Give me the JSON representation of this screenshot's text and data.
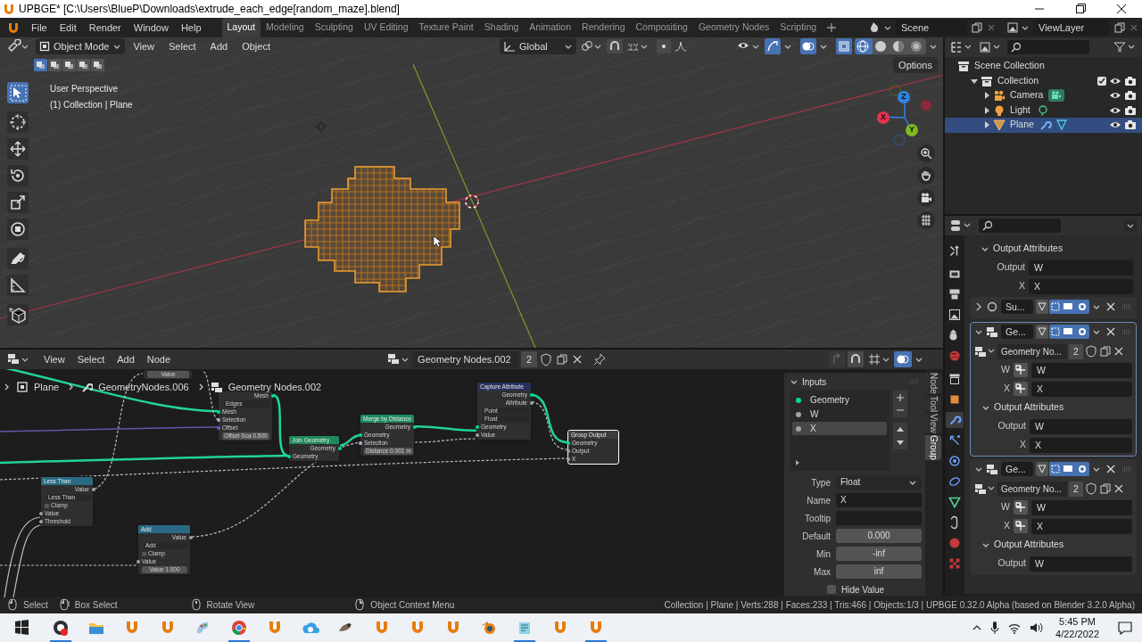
{
  "window": {
    "title": "UPBGE* [C:\\Users\\BlueP\\Downloads\\extrude_each_edge[random_maze].blend]"
  },
  "menu": [
    "File",
    "Edit",
    "Render",
    "Window",
    "Help"
  ],
  "workspaces": [
    {
      "label": "Layout",
      "selected": true
    },
    {
      "label": "Modeling",
      "selected": false
    },
    {
      "label": "Sculpting",
      "selected": false
    },
    {
      "label": "UV Editing",
      "selected": false
    },
    {
      "label": "Texture Paint",
      "selected": false
    },
    {
      "label": "Shading",
      "selected": false
    },
    {
      "label": "Animation",
      "selected": false
    },
    {
      "label": "Rendering",
      "selected": false
    },
    {
      "label": "Compositing",
      "selected": false
    },
    {
      "label": "Geometry Nodes",
      "selected": false
    },
    {
      "label": "Scripting",
      "selected": false
    }
  ],
  "scene": "Scene",
  "view_layer": "ViewLayer",
  "viewport": {
    "mode": "Object Mode",
    "menus": [
      "View",
      "Select",
      "Add",
      "Object"
    ],
    "orientation": "Global",
    "options": "Options",
    "select_modes": [
      {
        "selected": true
      },
      {
        "selected": false
      },
      {
        "selected": false
      },
      {
        "selected": false
      },
      {
        "selected": false
      }
    ],
    "shading": [
      {
        "kind": "wireframe",
        "selected": true
      },
      {
        "kind": "solid",
        "selected": false
      },
      {
        "kind": "material",
        "selected": false
      },
      {
        "kind": "rendered",
        "selected": false
      }
    ],
    "overlay_lines": [
      "User Perspective",
      "(1) Collection | Plane"
    ],
    "tools": [
      {
        "kind": "select",
        "selected": true
      },
      {
        "kind": "cursor",
        "selected": false
      },
      {
        "kind": "move",
        "selected": false
      },
      {
        "kind": "rotate",
        "selected": false
      },
      {
        "kind": "scale",
        "selected": false
      },
      {
        "kind": "transform",
        "selected": false
      },
      {
        "kind": "annotate",
        "selected": false
      },
      {
        "kind": "measure",
        "selected": false
      },
      {
        "kind": "add-cube",
        "selected": false
      }
    ],
    "gizmo": [
      {
        "label": "Z",
        "color": "#2f83e3"
      },
      {
        "label": "X",
        "color": "#e2344f"
      },
      {
        "label": "Y",
        "color": "#7dba1e"
      }
    ]
  },
  "outliner": {
    "tree": [
      {
        "label": "Scene Collection",
        "kind": "scene-collection",
        "selected": false,
        "children": [
          {
            "label": "Collection",
            "kind": "collection",
            "expanded": true,
            "checked": true,
            "selected": false,
            "children": [
              {
                "label": "Camera",
                "kind": "camera",
                "expanded": false,
                "selected": false
              },
              {
                "label": "Light",
                "kind": "light",
                "expanded": false,
                "selected": false
              },
              {
                "label": "Plane",
                "kind": "mesh",
                "expanded": false,
                "selected": true
              }
            ]
          }
        ]
      }
    ]
  },
  "node_editor": {
    "menus": [
      "View",
      "Select",
      "Add",
      "Node"
    ],
    "node_group": "Geometry Nodes.002",
    "users": "2",
    "breadcrumbs": [
      "Plane",
      "GeometryNodes.006",
      "Geometry Nodes.002"
    ],
    "nodes": [
      {
        "selected": false,
        "rows": [
          {
            "kind": "field",
            "label": "Value"
          }
        ]
      },
      {
        "selected": false,
        "rows": [
          {
            "kind": "out",
            "color": "#00d6a3",
            "label": "Mesh"
          },
          {
            "kind": "dropdown",
            "label": "Edges"
          },
          {
            "kind": "in",
            "color": "#00d6a3",
            "label": "Mesh"
          },
          {
            "kind": "in",
            "color": "#cca6d6",
            "label": "Selection"
          },
          {
            "kind": "in",
            "color": "#6363c7",
            "label": "Offset"
          },
          {
            "kind": "field",
            "label": "Offset Sca 0.500"
          }
        ]
      },
      {
        "title": "Join Geometry",
        "color": "#1f8a5e",
        "selected": false,
        "rows": [
          {
            "kind": "out",
            "color": "#00d6a3",
            "label": "Geometry"
          },
          {
            "kind": "in",
            "color": "#00d6a3",
            "label": "Geometry"
          }
        ]
      },
      {
        "title": "Merge by Distance",
        "color": "#1f8a5e",
        "selected": false,
        "rows": [
          {
            "kind": "out",
            "color": "#00d6a3",
            "label": "Geometry"
          },
          {
            "kind": "in",
            "color": "#00d6a3",
            "label": "Geometry"
          },
          {
            "kind": "in",
            "color": "#cca6d6",
            "label": "Selection"
          },
          {
            "kind": "field",
            "label": "Distance 0.001 m"
          }
        ]
      },
      {
        "title": "Capture Attribute",
        "color": "#27305e",
        "selected": false,
        "rows": [
          {
            "kind": "out",
            "color": "#00d6a3",
            "label": "Geometry"
          },
          {
            "kind": "out",
            "color": "#a1a1a1",
            "label": "Attribute"
          },
          {
            "kind": "dropdown",
            "label": "Point"
          },
          {
            "kind": "dropdown",
            "label": "Float"
          },
          {
            "kind": "in",
            "color": "#00d6a3",
            "label": "Geometry"
          },
          {
            "kind": "in",
            "color": "#a1a1a1",
            "label": "Value"
          }
        ]
      },
      {
        "title": "Group Output",
        "color": "#3c3c3c",
        "selected": true,
        "rows": [
          {
            "kind": "in",
            "color": "#00d6a3",
            "label": "Geometry"
          },
          {
            "kind": "in",
            "color": "#a1a1a1",
            "label": "Output"
          },
          {
            "kind": "in",
            "color": "#a1a1a1",
            "label": "X"
          }
        ]
      },
      {
        "title": "Less Than",
        "color": "#2a6a85",
        "selected": false,
        "rows": [
          {
            "kind": "out",
            "color": "#a1a1a1",
            "label": "Value"
          },
          {
            "kind": "dropdown",
            "label": "Less Than"
          },
          {
            "kind": "check",
            "label": "Clamp",
            "checked": false
          },
          {
            "kind": "in",
            "color": "#a1a1a1",
            "label": "Value"
          },
          {
            "kind": "in",
            "color": "#a1a1a1",
            "label": "Threshold"
          }
        ]
      },
      {
        "title": "Add",
        "color": "#2a6a85",
        "selected": false,
        "rows": [
          {
            "kind": "out",
            "color": "#a1a1a1",
            "label": "Value"
          },
          {
            "kind": "dropdown",
            "label": "Add"
          },
          {
            "kind": "check",
            "label": "Clamp",
            "checked": false
          },
          {
            "kind": "in",
            "color": "#a1a1a1",
            "label": "Value"
          },
          {
            "kind": "field",
            "label": "Value 1.000"
          }
        ]
      }
    ]
  },
  "sidebar": {
    "tabs": [
      {
        "label": "Node",
        "selected": false
      },
      {
        "label": "Tool",
        "selected": false
      },
      {
        "label": "View",
        "selected": false
      },
      {
        "label": "Group",
        "selected": true
      }
    ],
    "panel": "Inputs",
    "inputs": [
      {
        "label": "Geometry",
        "color": "#00d6a3",
        "selected": false
      },
      {
        "label": "W",
        "color": "#a1a1a1",
        "selected": false
      },
      {
        "label": "X",
        "color": "#a1a1a1",
        "selected": true
      }
    ],
    "fields": [
      {
        "kind": "dropdown",
        "label": "Type",
        "value": "Float"
      },
      {
        "kind": "text",
        "label": "Name",
        "value": "X"
      },
      {
        "kind": "text",
        "label": "Tooltip"
      },
      {
        "kind": "number",
        "label": "Default",
        "value": "0.000"
      },
      {
        "kind": "number",
        "label": "Min",
        "value": "-inf"
      },
      {
        "kind": "number",
        "label": "Max",
        "value": "inf"
      },
      {
        "kind": "check",
        "label": "Hide Value",
        "checked": false
      }
    ]
  },
  "properties": {
    "tabs": [
      {
        "kind": "tool",
        "selected": false
      },
      {
        "kind": "render",
        "selected": false
      },
      {
        "kind": "output",
        "selected": false
      },
      {
        "kind": "view-layer",
        "selected": false
      },
      {
        "kind": "scene",
        "selected": false
      },
      {
        "kind": "world",
        "selected": false
      },
      {
        "kind": "collection",
        "selected": false
      },
      {
        "kind": "object",
        "selected": false
      },
      {
        "kind": "modifier",
        "selected": true
      },
      {
        "kind": "particles",
        "selected": false
      },
      {
        "kind": "physics",
        "selected": false
      },
      {
        "kind": "constraints",
        "selected": false
      },
      {
        "kind": "data",
        "selected": false
      },
      {
        "kind": "shader",
        "selected": false
      },
      {
        "kind": "material",
        "selected": false
      },
      {
        "kind": "texture",
        "selected": false
      }
    ],
    "blocks": [
      {
        "kind": "section",
        "label": "Output Attributes",
        "rows": [
          {
            "label": "Output",
            "value": "W"
          },
          {
            "label": "X",
            "value": "X"
          }
        ]
      },
      {
        "kind": "modifier",
        "name": "Su...",
        "expanded": false,
        "active": false
      },
      {
        "kind": "modifier",
        "name": "Ge...",
        "expanded": true,
        "active": true,
        "group": "Geometry No...",
        "users": "2",
        "inputs": [
          {
            "label": "W",
            "value": "W"
          },
          {
            "label": "X",
            "value": "X"
          }
        ],
        "outputs_label": "Output Attributes",
        "outputs": [
          {
            "label": "Output",
            "value": "W"
          },
          {
            "label": "X",
            "value": "X"
          }
        ]
      },
      {
        "kind": "modifier",
        "name": "Ge...",
        "expanded": true,
        "active": false,
        "group": "Geometry No...",
        "users": "2",
        "inputs": [
          {
            "label": "W",
            "value": "W"
          },
          {
            "label": "X",
            "value": "X"
          }
        ],
        "outputs_label": "Output Attributes",
        "outputs": [
          {
            "label": "Output",
            "value": "W"
          }
        ]
      }
    ]
  },
  "status_bar": {
    "hints": [
      {
        "kind": "left",
        "label": "Select"
      },
      {
        "kind": "drag",
        "label": "Box Select"
      },
      {
        "kind": "middle",
        "label": "Rotate View"
      },
      {
        "kind": "right",
        "label": "Object Context Menu"
      }
    ],
    "stats": "Collection | Plane | Verts:288 | Faces:233 | Tris:466 | Objects:1/3 | UPBGE 0.32.0 Alpha (based on Blender 3.2.0 Alpha)"
  },
  "taskbar": {
    "apps": [
      {
        "kind": "recorder",
        "running": true
      },
      {
        "kind": "folder",
        "running": false
      },
      {
        "kind": "upbge",
        "running": false
      },
      {
        "kind": "upbge",
        "running": false
      },
      {
        "kind": "paint",
        "running": false
      },
      {
        "kind": "chrome",
        "running": true
      },
      {
        "kind": "upbge",
        "running": false
      },
      {
        "kind": "cloud",
        "running": false
      },
      {
        "kind": "gimp",
        "running": false
      },
      {
        "kind": "upbge",
        "running": false
      },
      {
        "kind": "upbge",
        "running": false
      },
      {
        "kind": "upbge",
        "running": false
      },
      {
        "kind": "blender",
        "running": false
      },
      {
        "kind": "notepad",
        "running": true
      },
      {
        "kind": "upbge",
        "running": false
      },
      {
        "kind": "upbge",
        "running": true
      }
    ],
    "time": "5:45 PM",
    "date": "4/22/2022"
  }
}
